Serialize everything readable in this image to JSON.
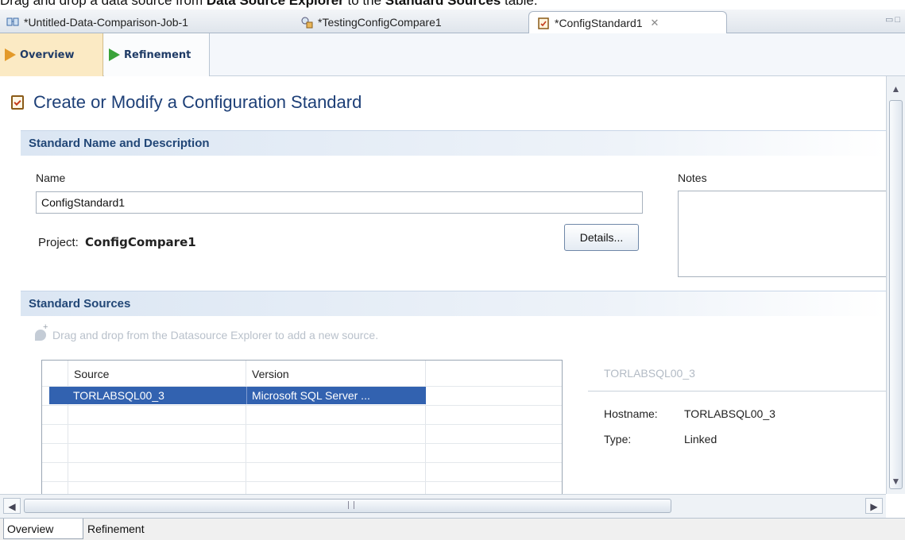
{
  "caption": {
    "pre": "Drag and drop a data source from ",
    "b1": "Data Source Explorer",
    "mid": " to the ",
    "b2": "Standard Sources",
    "post": " table."
  },
  "tabs": [
    {
      "label": "*Untitled-Data-Comparison-Job-1",
      "icon": "data-compare-job-icon"
    },
    {
      "label": "*TestingConfigCompare1",
      "icon": "config-compare-icon"
    },
    {
      "label": "*ConfigStandard1",
      "icon": "config-standard-icon"
    }
  ],
  "editor_tabs": {
    "overview": "Overview",
    "refinement": "Refinement"
  },
  "page": {
    "title": "Create or Modify a Configuration Standard"
  },
  "section_name": {
    "header": "Standard Name and Description",
    "name_label": "Name",
    "name_value": "ConfigStandard1",
    "notes_label": "Notes",
    "project_label": "Project:",
    "project_value": "ConfigCompare1",
    "details_button": "Details..."
  },
  "section_sources": {
    "header": "Standard Sources",
    "hint": "Drag and drop from the Datasource Explorer to add a new source.",
    "columns": [
      "Source",
      "Version"
    ],
    "rows": [
      {
        "source": "TORLABSQL00_3",
        "version": "Microsoft SQL Server ..."
      }
    ],
    "detail": {
      "title": "TORLABSQL00_3",
      "hostname_label": "Hostname:",
      "hostname_value": "TORLABSQL00_3",
      "type_label": "Type:",
      "type_value": "Linked"
    }
  },
  "bottom_tabs": [
    "Overview",
    "Refinement"
  ]
}
